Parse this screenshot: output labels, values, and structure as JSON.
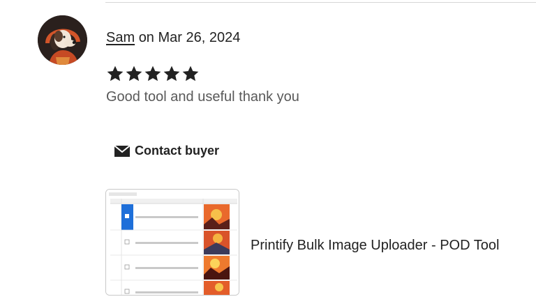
{
  "review": {
    "reviewer_name": "Sam",
    "date_text": "on Mar 26, 2024",
    "rating": 5,
    "rating_max": 5,
    "text": "Good tool and useful thank you"
  },
  "actions": {
    "contact_label": "Contact buyer"
  },
  "product": {
    "title": "Printify Bulk Image Uploader - POD Tool"
  },
  "icons": {
    "avatar": "dog-astronaut-avatar",
    "star": "star-icon",
    "contact": "mail-icon"
  },
  "colors": {
    "text_primary": "#222222",
    "text_secondary": "#595959",
    "star": "#222222",
    "divider": "#d6d6d6"
  }
}
